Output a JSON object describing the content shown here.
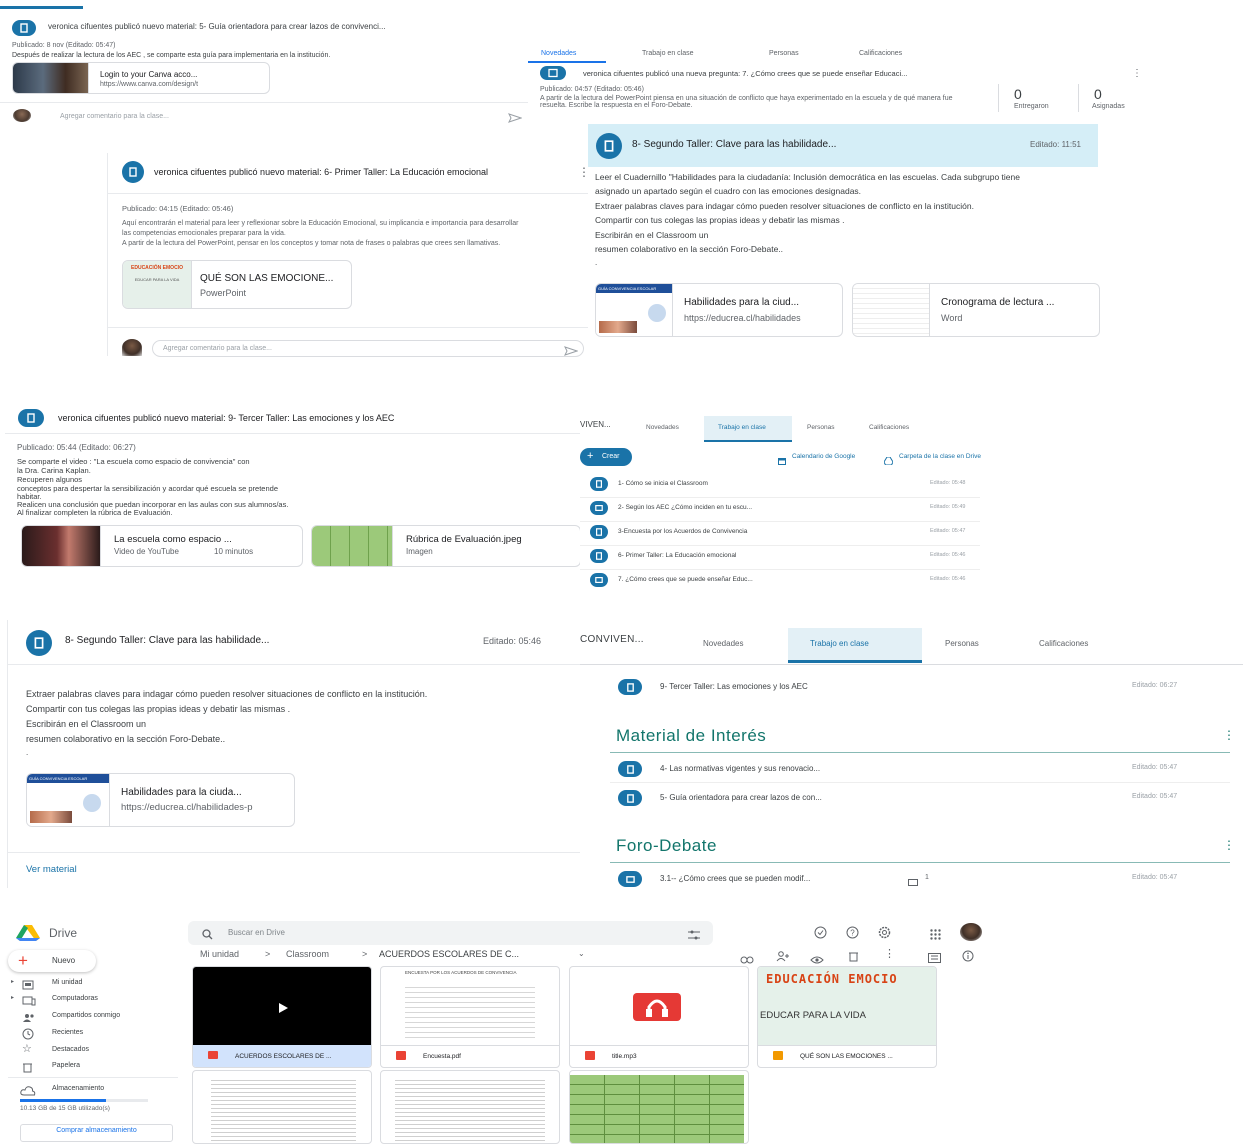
{
  "p1": {
    "title": "veronica cifuentes publicó nuevo material: 5- Guía orientadora para crear lazos de convivenci...",
    "meta": "Publicado: 8 nov (Editado: 05:47)",
    "desc": "Después de realizar la lectura de los AEC , se comparte esta guía para implementaria en la institución.",
    "att_title": "Login to your Canva acco...",
    "att_url": "https://www.canva.com/design/t",
    "comment_ph": "Agregar comentario para la clase..."
  },
  "p2": {
    "tabs": [
      "Novedades",
      "Trabajo en clase",
      "Personas",
      "Calificaciones"
    ],
    "title": "veronica cifuentes publicó una nueva pregunta: 7. ¿Cómo crees que se puede enseñar Educaci...",
    "meta": "Publicado: 04:57 (Editado: 05:46)",
    "desc": "A partir de la lectura del PowerPoint piensa en una situación de conflicto que haya experimentado en la escuela y de qué manera fue resuelta. Escribe la respuesta en el Foro-Debate.",
    "stat1_value": "0",
    "stat1_label": "Entregaron",
    "stat2_value": "0",
    "stat2_label": "Asignadas"
  },
  "p3": {
    "title": "veronica cifuentes publicó nuevo material: 6- Primer Taller: La Educación emocional",
    "meta": "Publicado: 04:15 (Editado: 05:46)",
    "desc1": "Aquí encontrarán el material para leer y reflexionar sobre la Educación Emocional, su implicancia e importancia para desarrollar",
    "desc2": "las competencias emocionales preparar para la vida.",
    "desc3": "A partir de la lectura del PowerPoint, pensar en los conceptos y tomar nota de frases o palabras que crees sen llamativas.",
    "thumb_t1": "EDUCACIÓN EMOCIO",
    "thumb_t2": "EDUCAR PARA LA VIDA",
    "att_title": "QUÉ SON LAS EMOCIONE...",
    "att_type": "PowerPoint",
    "comment_ph": "Agregar comentario para la clase..."
  },
  "p4": {
    "title": "8- Segundo Taller: Clave para las habilidade...",
    "edited": "Editado: 11:51",
    "lines": [
      "Leer el Cuadernillo \"Habilidades para la ciudadanía: Inclusión democrática en las escuelas. Cada subgrupo tiene",
      "asignado un apartado según el cuadro con las emociones designadas.",
      "Extraer palabras claves para indagar cómo pueden resolver situaciones de conflicto en la institución.",
      "Compartir con tus colegas las propias  ideas y debatir las mismas .",
      "Escribirán en el Classroom un",
      "resumen colaborativo en la sección Foro-Debate.."
    ],
    "dot": ".",
    "thumb_head": "GUÍA CONVIVENCIA ESCOLAR",
    "att1_title": "Habilidades para la ciud...",
    "att1_url": "https://educrea.cl/habilidades",
    "att2_title": "Cronograma de lectura ...",
    "att2_type": "Word"
  },
  "p5": {
    "title": "veronica cifuentes publicó nuevo material: 9- Tercer Taller: Las emociones y los AEC",
    "meta": "Publicado: 05:44 (Editado: 06:27)",
    "lines": [
      "Se comparte el video : \"La escuela como espacio de convivencia\" con",
      "la Dra. Carina Kaplan.",
      "Recuperen algunos",
      "conceptos para despertar la sensibilización y acordar qué escuela se pretende",
      "habitar.",
      "Realicen una conclusión que puedan incorporar en las aulas con sus alumnos/as.",
      "Al finalizar completen la rúbrica de Evaluación."
    ],
    "att1_title": "La escuela como espacio ...",
    "att1_type": "Video de YouTube",
    "att1_dur": "10 minutos",
    "att2_title": "Rúbrica de Evaluación.jpeg",
    "att2_type": "Imagen"
  },
  "p6": {
    "class_name": "VIVEN...",
    "tabs": [
      "Novedades",
      "Trabajo en clase",
      "Personas",
      "Calificaciones"
    ],
    "create": "Crear",
    "calendar": "Calendario de Google",
    "folder": "Carpeta de la clase en Drive",
    "items": [
      {
        "title": "1- Cómo se inicia el Classroom",
        "edited": "Editado: 05:48"
      },
      {
        "title": "2- Según los AEC ¿Cómo inciden en tu escu...",
        "edited": "Editado: 05:49"
      },
      {
        "title": "3-Encuesta por los Acuerdos de Convivencia",
        "edited": "Editado: 05:47"
      },
      {
        "title": "6- Primer Taller: La Educación emocional",
        "edited": "Editado: 05:46"
      },
      {
        "title": "7. ¿Cómo crees que se puede enseñar Educ...",
        "edited": "Editado: 05:46"
      }
    ]
  },
  "p7": {
    "title": "8- Segundo Taller: Clave para las habilidade...",
    "edited": "Editado: 05:46",
    "lines": [
      "Extraer palabras claves para indagar cómo pueden resolver situaciones de conflicto en la institución.",
      "Compartir con tus colegas las propias  ideas y debatir las mismas .",
      "Escribirán en el Classroom un",
      "resumen colaborativo en la sección Foro-Debate.."
    ],
    "dot": ".",
    "thumb_head": "GUÍA CONVIVENCIA ESCOLAR",
    "att_title": "Habilidades para la ciuda...",
    "att_url": "https://educrea.cl/habilidades-p",
    "view": "Ver material"
  },
  "p8": {
    "class_name": "CONVIVEN...",
    "tabs": [
      "Novedades",
      "Trabajo en clase",
      "Personas",
      "Calificaciones"
    ],
    "top_item": {
      "title": "9- Tercer Taller: Las emociones y los AEC",
      "edited": "Editado: 06:27"
    },
    "section1": "Material de Interés",
    "s1_items": [
      {
        "title": "4- Las normativas vigentes y sus renovacio...",
        "edited": "Editado: 05:47"
      },
      {
        "title": "5- Guía orientadora para crear lazos de con...",
        "edited": "Editado: 05:47"
      }
    ],
    "section2": "Foro-Debate",
    "s2_item": {
      "title": "3.1-- ¿Cómo crees que se pueden modif...",
      "count": "1",
      "edited": "Editado: 05:47"
    }
  },
  "drive": {
    "logo": "Drive",
    "search_ph": "Buscar en Drive",
    "new": "Nuevo",
    "nav": [
      "Mi unidad",
      "Computadoras",
      "Compartidos conmigo",
      "Recientes",
      "Destacados",
      "Papelera"
    ],
    "storage": "Almacenamiento",
    "storage_used": "10.13 GB de 15 GB utilizado(s)",
    "buy": "Comprar almacenamiento",
    "breadcrumb": [
      "Mi unidad",
      "Classroom",
      "ACUERDOS ESCOLARES DE C..."
    ],
    "files": [
      {
        "name": "ACUERDOS ESCOLARES DE ..."
      },
      {
        "name": "Encuesta.pdf"
      },
      {
        "name": "title.mp3"
      },
      {
        "name": "QUÉ SON LAS EMOCIONES ..."
      }
    ],
    "doc_head": "ENCUESTA POR LOS ACUERDOS DE CONVIVENCIA",
    "slide_t1": "EDUCACIÓN EMOCIO",
    "slide_t2": "EDUCAR PARA LA VIDA"
  }
}
